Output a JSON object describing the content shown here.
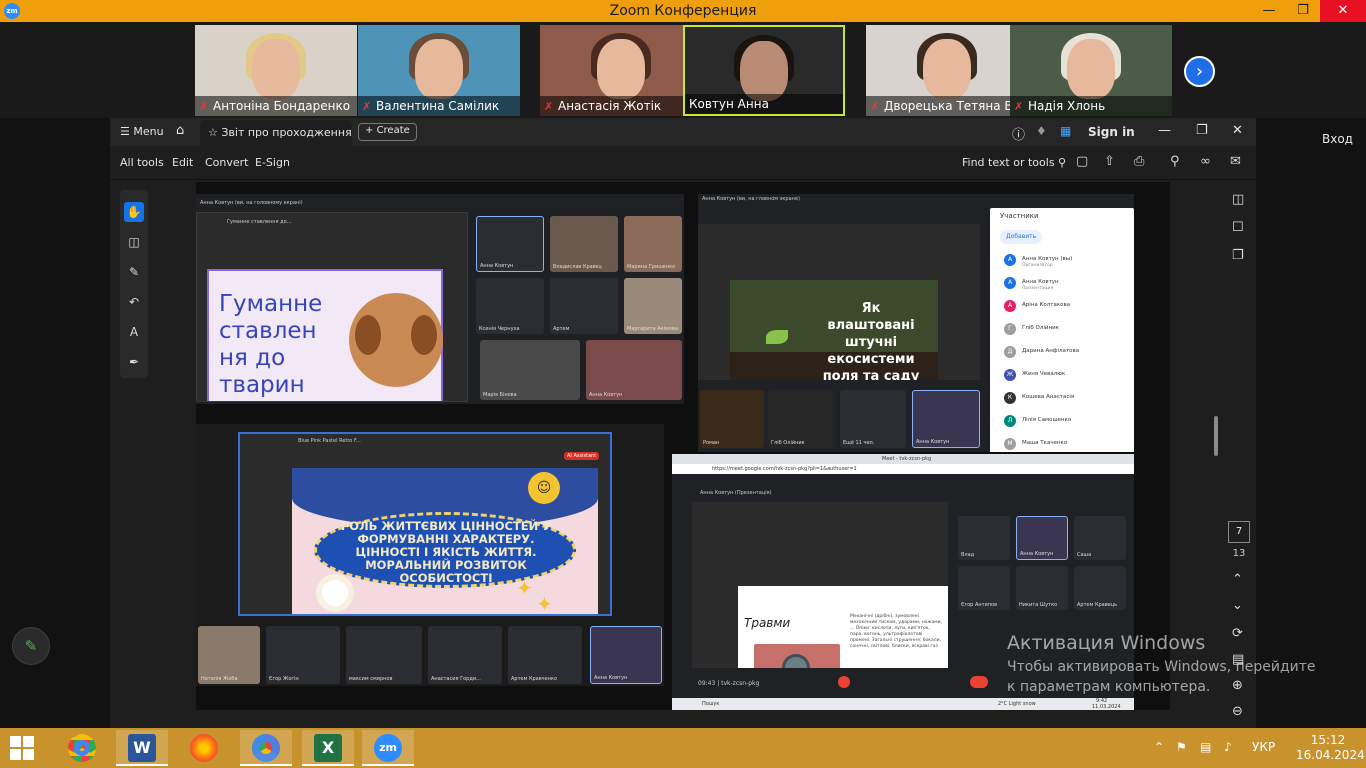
{
  "zoom": {
    "window_title": "Zoom Конференция",
    "logo_text": "zm",
    "participants": [
      {
        "name": "Антоніна Бондаренко",
        "muted": true
      },
      {
        "name": "Валентина Самілик",
        "muted": true
      },
      {
        "name": "Анастасія Жотік",
        "muted": true
      },
      {
        "name": "Ковтун Анна",
        "muted": false,
        "active": true
      },
      {
        "name": "Дворецька Тетяна В...",
        "muted": true
      },
      {
        "name": "Надія Хлонь",
        "muted": true
      }
    ],
    "right_label": "Вход"
  },
  "acrobat": {
    "menu_label": "Menu",
    "tab_title": "Звіт про проходження ...",
    "create_label": "Create",
    "signin_label": "Sign in",
    "tools": [
      "All tools",
      "Edit",
      "Convert",
      "E-Sign"
    ],
    "find_label": "Find text or tools",
    "current_page": "7",
    "total_pages": "13"
  },
  "shot_a": {
    "header_text": "Анна Ковтун (ви, на головному екрані)",
    "tab_text": "Гуманне ставлення до...",
    "slide_title": "Гуманне ставлен ня до тварин",
    "cams": [
      "Анна Ковтун",
      "Владислав Кравєц",
      "Марина Гришенко",
      "Ксенія Чернуха",
      "Артем",
      "Маргарита Акімова",
      "Марія Бінова",
      "Анна Ковтун"
    ]
  },
  "shot_b": {
    "header_text": "Анна Ковтун (ви, на главном экране)",
    "slide_title": "Як влаштовані штучні екосистеми поля та саду",
    "cams": [
      "Роман",
      "Гліб Олійник",
      "Ещё 11 чел.",
      "Анна Ковтун"
    ],
    "panel_title": "Участники",
    "add_label": "Добавить",
    "people": [
      {
        "name": "Анна Ковтун (вы)",
        "sub": "Организатор",
        "color": "#1a73e8",
        "initial": "А"
      },
      {
        "name": "Анна Ковтун",
        "sub": "Презентация",
        "color": "#1a73e8",
        "initial": "А"
      },
      {
        "name": "Аріна Колтакова",
        "sub": "",
        "color": "#e91e63",
        "initial": "А"
      },
      {
        "name": "Гліб Олійник",
        "sub": "",
        "color": "#9e9e9e",
        "initial": "Г"
      },
      {
        "name": "Дарина Анфілатова",
        "sub": "",
        "color": "#9e9e9e",
        "initial": "Д"
      },
      {
        "name": "Женя Чевалюк",
        "sub": "",
        "color": "#3f51b5",
        "initial": "Ж"
      },
      {
        "name": "Кошева Анастасія",
        "sub": "",
        "color": "#333333",
        "initial": "К"
      },
      {
        "name": "Лілія Самошенко",
        "sub": "",
        "color": "#00897b",
        "initial": "Л"
      },
      {
        "name": "Маша Ткаченко",
        "sub": "",
        "color": "#9e9e9e",
        "initial": "М"
      }
    ]
  },
  "shot_c": {
    "tab_text": "Blue Pink Pastel Retro F...",
    "ai_label": "AI Assistant",
    "slide_title": "РОЛЬ ЖИТТЄВИХ ЦІННОСТЕЙ У ФОРМУВАННІ ХАРАКТЕРУ. ЦІННОСТІ І ЯКІСТЬ ЖИТТЯ. МОРАЛЬНИЙ РОЗВИТОК ОСОБИСТОСТІ",
    "cams": [
      "Наталія Жоба",
      "Єгор Жогін",
      "максим смирнов",
      "Анастасия Горди...",
      "Артем Кравченко",
      "Анна Ковтун"
    ]
  },
  "shot_d": {
    "browser_tab": "Meet - tvk-zcsn-pkg",
    "url": "https://meet.google.com/tvk-zcsn-pkg?pli=1&authuser=1",
    "header_text": "Анна Ковтун (Презентація)",
    "slide_title": "Травми",
    "slide_text": "Механічні (дрібні), зумовлені механічний тиском, ударами, ножами, ... Опіки: кислоти, луги, кип'яток, пара, вогонь, ультрафіолетові промені. Загальні струшення: бокали, сонячні, світлові, блиски, яскраві газ",
    "cams": [
      "Влад",
      "Анна Ковтун",
      "Саша",
      "Єгор Антипов",
      "Никита Шутко",
      "Артем Кравець"
    ],
    "meeting_code": "09:43 | tvk-zcsn-pkg",
    "search_label": "Пошук",
    "tray_temp": "2°C Light snow",
    "tray_time": "9:42",
    "tray_date": "11.03.2024"
  },
  "watermark": {
    "line1": "Активация Windows",
    "line2": "Чтобы активировать Windows, перейдите к параметрам компьютера."
  },
  "taskbar": {
    "lang": "УКР",
    "time": "15:12",
    "date": "16.04.2024"
  },
  "colors": {
    "zoom_title_bg": "#ef9f0b",
    "taskbar_bg": "#c8922d",
    "accent_blue": "#1473e6"
  }
}
